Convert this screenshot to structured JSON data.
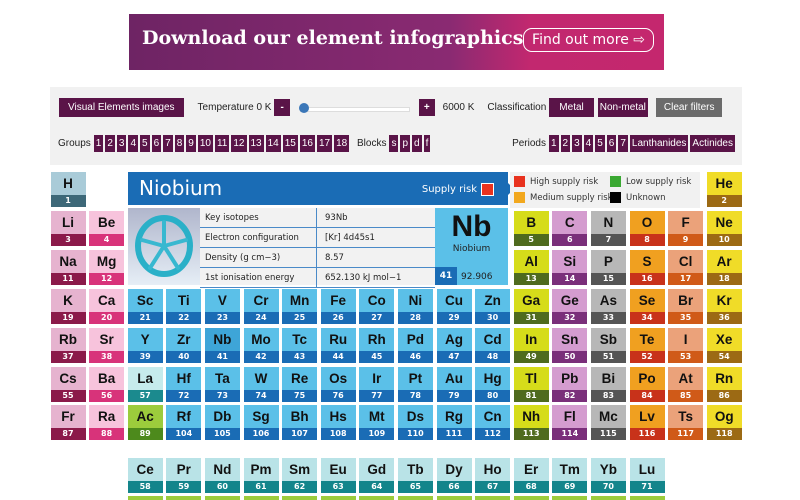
{
  "banner": {
    "title": "Download our element infographics",
    "button": "Find out more"
  },
  "controls": {
    "images_btn": "Visual Elements images",
    "temperature_label": "Temperature 0 K",
    "minus": "-",
    "plus": "+",
    "temp_max": "6000 K",
    "temperature_value": 0,
    "classification_label": "Classification",
    "metal": "Metal",
    "nonmetal": "Non-metal",
    "clear": "Clear filters",
    "groups_label": "Groups",
    "groups": [
      "1",
      "2",
      "3",
      "4",
      "5",
      "6",
      "7",
      "8",
      "9",
      "10",
      "11",
      "12",
      "13",
      "14",
      "15",
      "16",
      "17",
      "18"
    ],
    "blocks_label": "Blocks",
    "blocks": [
      "s",
      "p",
      "d",
      "f"
    ],
    "periods_label": "Periods",
    "periods": [
      "1",
      "2",
      "3",
      "4",
      "5",
      "6",
      "7",
      "Lanthanides",
      "Actinides"
    ]
  },
  "info": {
    "name": "Niobium",
    "supply_risk": "Supply risk",
    "supply_risk_color": "#e8321e",
    "rows": [
      [
        "Key isotopes",
        "93Nb"
      ],
      [
        "Electron configuration",
        "[Kr] 4d45s1"
      ],
      [
        "Density (g cm−3)",
        "8.57"
      ],
      [
        "1st ionisation energy",
        "652.130 kJ mol−1"
      ]
    ],
    "symbol": "Nb",
    "number": "41",
    "mass": "92.906"
  },
  "legend": [
    {
      "label": "High supply risk",
      "color": "#e8321e"
    },
    {
      "label": "Low supply risk",
      "color": "#3aa832"
    },
    {
      "label": "Medium supply risk",
      "color": "#f2a81e"
    },
    {
      "label": "Unknown",
      "color": "#000000"
    }
  ],
  "categories": {
    "h": [
      "#a9cbd8",
      "#3d6878"
    ],
    "alk": [
      "#e6b3cf",
      "#8b1a4a"
    ],
    "ae": [
      "#f7c3dc",
      "#d8337a"
    ],
    "tm": [
      "#5bc0e8",
      "#1a6cb5"
    ],
    "sel": [
      "#3ea5d8",
      "#1a6cb5"
    ],
    "la": [
      "#c6ebec",
      "#1b8a8e"
    ],
    "ac": [
      "#9ccc3c",
      "#4d8a1c"
    ],
    "g13": [
      "#d6dc1a",
      "#4f6b1e"
    ],
    "g14": [
      "#d49ccf",
      "#7a2f7a"
    ],
    "g15": [
      "#b7b7b7",
      "#555555"
    ],
    "g16": [
      "#f0a020",
      "#c8321a"
    ],
    "g17": [
      "#eba27a",
      "#d05a18"
    ],
    "g18": [
      "#f0dc28",
      "#9c6a14"
    ],
    "lan": [
      "#b9e3e7",
      "#13858b"
    ],
    "act": [
      "#9ccc3c",
      "#4d8a1c"
    ]
  },
  "elements": [
    [
      "H",
      1,
      1,
      1,
      "h"
    ],
    [
      "He",
      2,
      1,
      18,
      "g18"
    ],
    [
      "Li",
      3,
      2,
      1,
      "alk"
    ],
    [
      "Be",
      4,
      2,
      2,
      "ae"
    ],
    [
      "B",
      5,
      2,
      13,
      "g13"
    ],
    [
      "C",
      6,
      2,
      14,
      "g14"
    ],
    [
      "N",
      7,
      2,
      15,
      "g15"
    ],
    [
      "O",
      8,
      2,
      16,
      "g16"
    ],
    [
      "F",
      9,
      2,
      17,
      "g17"
    ],
    [
      "Ne",
      10,
      2,
      18,
      "g18"
    ],
    [
      "Na",
      11,
      3,
      1,
      "alk"
    ],
    [
      "Mg",
      12,
      3,
      2,
      "ae"
    ],
    [
      "Al",
      13,
      3,
      13,
      "g13"
    ],
    [
      "Si",
      14,
      3,
      14,
      "g14"
    ],
    [
      "P",
      15,
      3,
      15,
      "g15"
    ],
    [
      "S",
      16,
      3,
      16,
      "g16"
    ],
    [
      "Cl",
      17,
      3,
      17,
      "g17"
    ],
    [
      "Ar",
      18,
      3,
      18,
      "g18"
    ],
    [
      "K",
      19,
      4,
      1,
      "alk"
    ],
    [
      "Ca",
      20,
      4,
      2,
      "ae"
    ],
    [
      "Sc",
      21,
      4,
      3,
      "tm"
    ],
    [
      "Ti",
      22,
      4,
      4,
      "tm"
    ],
    [
      "V",
      23,
      4,
      5,
      "tm"
    ],
    [
      "Cr",
      24,
      4,
      6,
      "tm"
    ],
    [
      "Mn",
      25,
      4,
      7,
      "tm"
    ],
    [
      "Fe",
      26,
      4,
      8,
      "tm"
    ],
    [
      "Co",
      27,
      4,
      9,
      "tm"
    ],
    [
      "Ni",
      28,
      4,
      10,
      "tm"
    ],
    [
      "Cu",
      29,
      4,
      11,
      "tm"
    ],
    [
      "Zn",
      30,
      4,
      12,
      "tm"
    ],
    [
      "Ga",
      31,
      4,
      13,
      "g13"
    ],
    [
      "Ge",
      32,
      4,
      14,
      "g14"
    ],
    [
      "As",
      33,
      4,
      15,
      "g15"
    ],
    [
      "Se",
      34,
      4,
      16,
      "g16"
    ],
    [
      "Br",
      35,
      4,
      17,
      "g17"
    ],
    [
      "Kr",
      36,
      4,
      18,
      "g18"
    ],
    [
      "Rb",
      37,
      5,
      1,
      "alk"
    ],
    [
      "Sr",
      38,
      5,
      2,
      "ae"
    ],
    [
      "Y",
      39,
      5,
      3,
      "tm"
    ],
    [
      "Zr",
      40,
      5,
      4,
      "tm"
    ],
    [
      "Nb",
      41,
      5,
      5,
      "sel"
    ],
    [
      "Mo",
      42,
      5,
      6,
      "tm"
    ],
    [
      "Tc",
      43,
      5,
      7,
      "tm"
    ],
    [
      "Ru",
      44,
      5,
      8,
      "tm"
    ],
    [
      "Rh",
      45,
      5,
      9,
      "tm"
    ],
    [
      "Pd",
      46,
      5,
      10,
      "tm"
    ],
    [
      "Ag",
      47,
      5,
      11,
      "tm"
    ],
    [
      "Cd",
      48,
      5,
      12,
      "tm"
    ],
    [
      "In",
      49,
      5,
      13,
      "g13"
    ],
    [
      "Sn",
      50,
      5,
      14,
      "g14"
    ],
    [
      "Sb",
      51,
      5,
      15,
      "g15"
    ],
    [
      "Te",
      52,
      5,
      16,
      "g16"
    ],
    [
      "I",
      53,
      5,
      17,
      "g17"
    ],
    [
      "Xe",
      54,
      5,
      18,
      "g18"
    ],
    [
      "Cs",
      55,
      6,
      1,
      "alk"
    ],
    [
      "Ba",
      56,
      6,
      2,
      "ae"
    ],
    [
      "La",
      57,
      6,
      3,
      "la"
    ],
    [
      "Hf",
      72,
      6,
      4,
      "tm"
    ],
    [
      "Ta",
      73,
      6,
      5,
      "tm"
    ],
    [
      "W",
      74,
      6,
      6,
      "tm"
    ],
    [
      "Re",
      75,
      6,
      7,
      "tm"
    ],
    [
      "Os",
      76,
      6,
      8,
      "tm"
    ],
    [
      "Ir",
      77,
      6,
      9,
      "tm"
    ],
    [
      "Pt",
      78,
      6,
      10,
      "tm"
    ],
    [
      "Au",
      79,
      6,
      11,
      "tm"
    ],
    [
      "Hg",
      80,
      6,
      12,
      "tm"
    ],
    [
      "Tl",
      81,
      6,
      13,
      "g13"
    ],
    [
      "Pb",
      82,
      6,
      14,
      "g14"
    ],
    [
      "Bi",
      83,
      6,
      15,
      "g15"
    ],
    [
      "Po",
      84,
      6,
      16,
      "g16"
    ],
    [
      "At",
      85,
      6,
      17,
      "g17"
    ],
    [
      "Rn",
      86,
      6,
      18,
      "g18"
    ],
    [
      "Fr",
      87,
      7,
      1,
      "alk"
    ],
    [
      "Ra",
      88,
      7,
      2,
      "ae"
    ],
    [
      "Ac",
      89,
      7,
      3,
      "ac"
    ],
    [
      "Rf",
      104,
      7,
      4,
      "tm"
    ],
    [
      "Db",
      105,
      7,
      5,
      "tm"
    ],
    [
      "Sg",
      106,
      7,
      6,
      "tm"
    ],
    [
      "Bh",
      107,
      7,
      7,
      "tm"
    ],
    [
      "Hs",
      108,
      7,
      8,
      "tm"
    ],
    [
      "Mt",
      109,
      7,
      9,
      "tm"
    ],
    [
      "Ds",
      110,
      7,
      10,
      "tm"
    ],
    [
      "Rg",
      111,
      7,
      11,
      "tm"
    ],
    [
      "Cn",
      112,
      7,
      12,
      "tm"
    ],
    [
      "Nh",
      113,
      7,
      13,
      "g13"
    ],
    [
      "Fl",
      114,
      7,
      14,
      "g14"
    ],
    [
      "Mc",
      115,
      7,
      15,
      "g15"
    ],
    [
      "Lv",
      116,
      7,
      16,
      "g16"
    ],
    [
      "Ts",
      117,
      7,
      17,
      "g17"
    ],
    [
      "Og",
      118,
      7,
      18,
      "g18"
    ],
    [
      "Ce",
      58,
      9,
      3,
      "lan"
    ],
    [
      "Pr",
      59,
      9,
      4,
      "lan"
    ],
    [
      "Nd",
      60,
      9,
      5,
      "lan"
    ],
    [
      "Pm",
      61,
      9,
      6,
      "lan"
    ],
    [
      "Sm",
      62,
      9,
      7,
      "lan"
    ],
    [
      "Eu",
      63,
      9,
      8,
      "lan"
    ],
    [
      "Gd",
      64,
      9,
      9,
      "lan"
    ],
    [
      "Tb",
      65,
      9,
      10,
      "lan"
    ],
    [
      "Dy",
      66,
      9,
      11,
      "lan"
    ],
    [
      "Ho",
      67,
      9,
      12,
      "lan"
    ],
    [
      "Er",
      68,
      9,
      13,
      "lan"
    ],
    [
      "Tm",
      69,
      9,
      14,
      "lan"
    ],
    [
      "Yb",
      70,
      9,
      15,
      "lan"
    ],
    [
      "Lu",
      71,
      9,
      16,
      "lan"
    ]
  ],
  "actinide_row_categories": "act"
}
